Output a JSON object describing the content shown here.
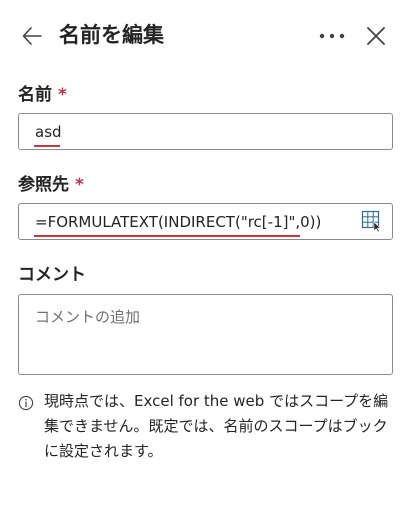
{
  "header": {
    "title": "名前を編集",
    "back_icon": "arrow-left-icon",
    "more_icon": "more-horizontal-icon",
    "close_icon": "close-icon"
  },
  "fields": {
    "name": {
      "label": "名前",
      "required_mark": "*",
      "value": "asd"
    },
    "refers_to": {
      "label": "参照先",
      "required_mark": "*",
      "value": "=FORMULATEXT(INDIRECT(\"rc[-1]\",0))",
      "picker_icon": "range-select-icon"
    },
    "comment": {
      "label": "コメント",
      "placeholder": "コメントの追加",
      "value": ""
    }
  },
  "info": {
    "icon": "info-icon",
    "text": "現時点では、Excel for the web ではスコープを編集できません。既定では、名前のスコープはブックに設定されます。"
  },
  "colors": {
    "text": "#242424",
    "required": "#c4314b",
    "spellcheck_underline": "#d13438",
    "border": "#8a8a8a",
    "placeholder": "#707070"
  }
}
